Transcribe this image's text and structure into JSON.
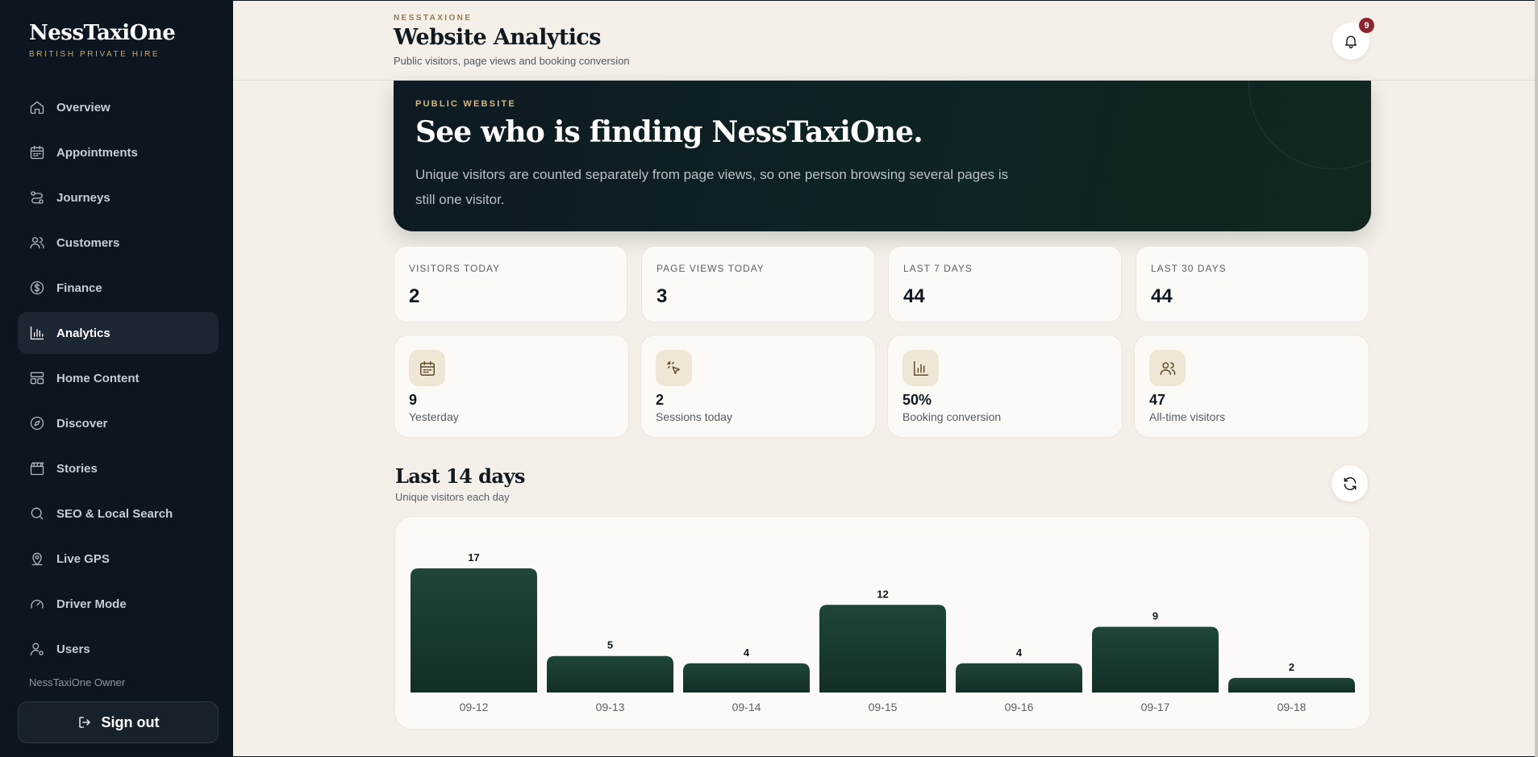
{
  "sidebar": {
    "brand_name": "NessTaxiOne",
    "brand_sub": "BRITISH PRIVATE HIRE",
    "items": [
      {
        "label": "Overview",
        "icon": "home-icon"
      },
      {
        "label": "Appointments",
        "icon": "calendar-icon"
      },
      {
        "label": "Journeys",
        "icon": "route-icon"
      },
      {
        "label": "Customers",
        "icon": "users-icon"
      },
      {
        "label": "Finance",
        "icon": "dollar-icon"
      },
      {
        "label": "Analytics",
        "icon": "bar-chart-icon",
        "active": true
      },
      {
        "label": "Home Content",
        "icon": "layout-icon"
      },
      {
        "label": "Discover",
        "icon": "compass-icon"
      },
      {
        "label": "Stories",
        "icon": "clapper-icon"
      },
      {
        "label": "SEO & Local Search",
        "icon": "search-icon"
      },
      {
        "label": "Live GPS",
        "icon": "map-pin-icon"
      },
      {
        "label": "Driver Mode",
        "icon": "gauge-icon"
      },
      {
        "label": "Users",
        "icon": "user-gear-icon"
      }
    ],
    "owner": "NessTaxiOne Owner",
    "signout_label": "Sign out"
  },
  "header": {
    "eyebrow": "NESSTAXIONE",
    "title": "Website Analytics",
    "subtitle": "Public visitors, page views and booking conversion",
    "notification_count": "9"
  },
  "hero": {
    "eyebrow": "PUBLIC WEBSITE",
    "title": "See who is finding NessTaxiOne.",
    "text": "Unique visitors are counted separately from page views, so one person browsing several pages is still one visitor."
  },
  "stats": [
    {
      "label": "VISITORS TODAY",
      "value": "2"
    },
    {
      "label": "PAGE VIEWS TODAY",
      "value": "3"
    },
    {
      "label": "LAST 7 DAYS",
      "value": "44"
    },
    {
      "label": "LAST 30 DAYS",
      "value": "44"
    }
  ],
  "kpis": [
    {
      "value": "9",
      "label": "Yesterday",
      "icon": "calendar-icon"
    },
    {
      "value": "2",
      "label": "Sessions today",
      "icon": "cursor-click-icon"
    },
    {
      "value": "50%",
      "label": "Booking conversion",
      "icon": "bar-chart-icon"
    },
    {
      "value": "47",
      "label": "All-time visitors",
      "icon": "users-icon"
    }
  ],
  "section": {
    "title": "Last 14 days",
    "subtitle": "Unique visitors each day"
  },
  "colors": {
    "sidebar_bg": "#0c1620",
    "main_bg": "#f4f0e9",
    "bar": "#1a3d30",
    "accent_gold": "#c7a56b",
    "badge": "#8e2430"
  },
  "chart_data": {
    "type": "bar",
    "categories": [
      "09-12",
      "09-13",
      "09-14",
      "09-15",
      "09-16",
      "09-17",
      "09-18"
    ],
    "values": [
      17,
      5,
      4,
      12,
      4,
      9,
      2
    ],
    "ylim": [
      0,
      17
    ],
    "grid": false,
    "data_labels": true
  }
}
